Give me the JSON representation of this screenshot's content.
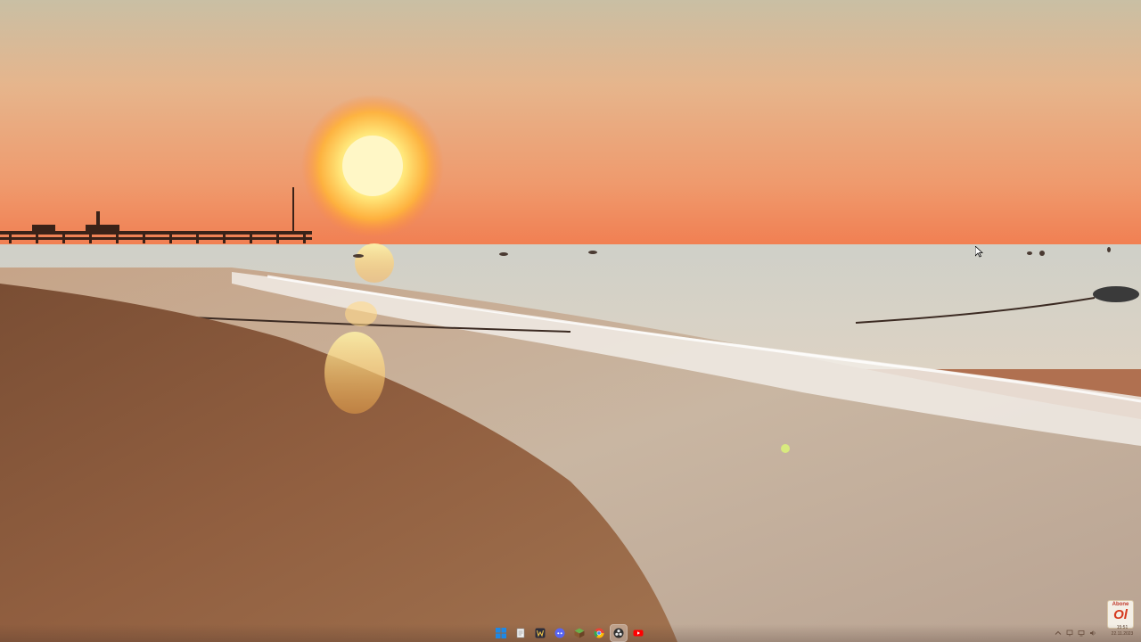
{
  "desktop": {
    "wallpaper": {
      "icon": "sunset-beach-wallpaper",
      "colors": {
        "sky_top": "#cbbca0",
        "sky_mid": "#eea37a",
        "horizon": "#f28453",
        "sun": "#fff6c8",
        "sea": "#d9cfc0",
        "sand": "#8a5a3e"
      }
    }
  },
  "taskbar": {
    "icons": [
      {
        "name": "start",
        "icon": "windows-logo-icon",
        "color": "#1e88e5"
      },
      {
        "name": "notepad",
        "icon": "notepad-icon",
        "color": "#f2f2f2"
      },
      {
        "name": "winamp",
        "icon": "winamp-icon",
        "color": "#2d2d3a"
      },
      {
        "name": "discord",
        "icon": "discord-icon",
        "color": "#5865f2"
      },
      {
        "name": "minecraft",
        "icon": "minecraft-icon",
        "color": "#5a8f2e"
      },
      {
        "name": "chrome",
        "icon": "chrome-icon",
        "color": "#ea4335"
      },
      {
        "name": "obs",
        "icon": "obs-studio-icon",
        "color": "#303030",
        "active": true
      },
      {
        "name": "youtube",
        "icon": "youtube-icon",
        "color": "#ff0000"
      }
    ],
    "tray": [
      {
        "name": "chevron",
        "icon": "chevron-up-icon"
      },
      {
        "name": "network",
        "icon": "network-icon"
      },
      {
        "name": "display",
        "icon": "display-icon"
      },
      {
        "name": "volume",
        "icon": "volume-icon"
      }
    ],
    "clock": {
      "time": "15:51",
      "date": "22.11.2023"
    }
  },
  "abone_badge": {
    "top": "Abone",
    "main": "Ol"
  }
}
